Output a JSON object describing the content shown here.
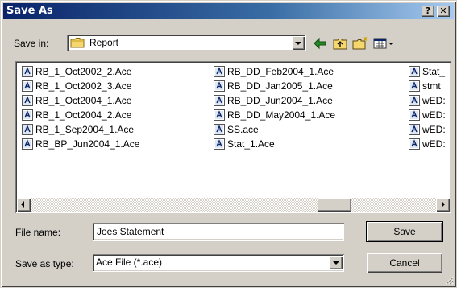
{
  "window": {
    "title": "Save As",
    "help_glyph": "?",
    "close_glyph": "✕"
  },
  "save_in": {
    "label": "Save in:",
    "value": "Report"
  },
  "toolbar": {
    "icons": [
      "back-arrow-icon",
      "up-folder-icon",
      "new-folder-icon",
      "views-menu-icon"
    ]
  },
  "files": {
    "col1": [
      "RB_1_Oct2002_2.Ace",
      "RB_1_Oct2002_3.Ace",
      "RB_1_Oct2004_1.Ace",
      "RB_1_Oct2004_2.Ace",
      "RB_1_Sep2004_1.Ace",
      "RB_BP_Jun2004_1.Ace"
    ],
    "col2": [
      "RB_DD_Feb2004_1.Ace",
      "RB_DD_Jan2005_1.Ace",
      "RB_DD_Jun2004_1.Ace",
      "RB_DD_May2004_1.Ace",
      "SS.ace",
      "Stat_1.Ace"
    ],
    "col3": [
      "Stat_",
      "stmt",
      "wED:",
      "wED:",
      "wED:",
      "wED:"
    ]
  },
  "file_name": {
    "label": "File name:",
    "value": "Joes Statement"
  },
  "save_as_type": {
    "label": "Save as type:",
    "value": "Ace File (*.ace)"
  },
  "buttons": {
    "save": "Save",
    "cancel": "Cancel"
  },
  "colors": {
    "title_start": "#0a246a",
    "title_end": "#a6caf0",
    "face": "#d4d0c8",
    "folder": "#f5d76e"
  }
}
